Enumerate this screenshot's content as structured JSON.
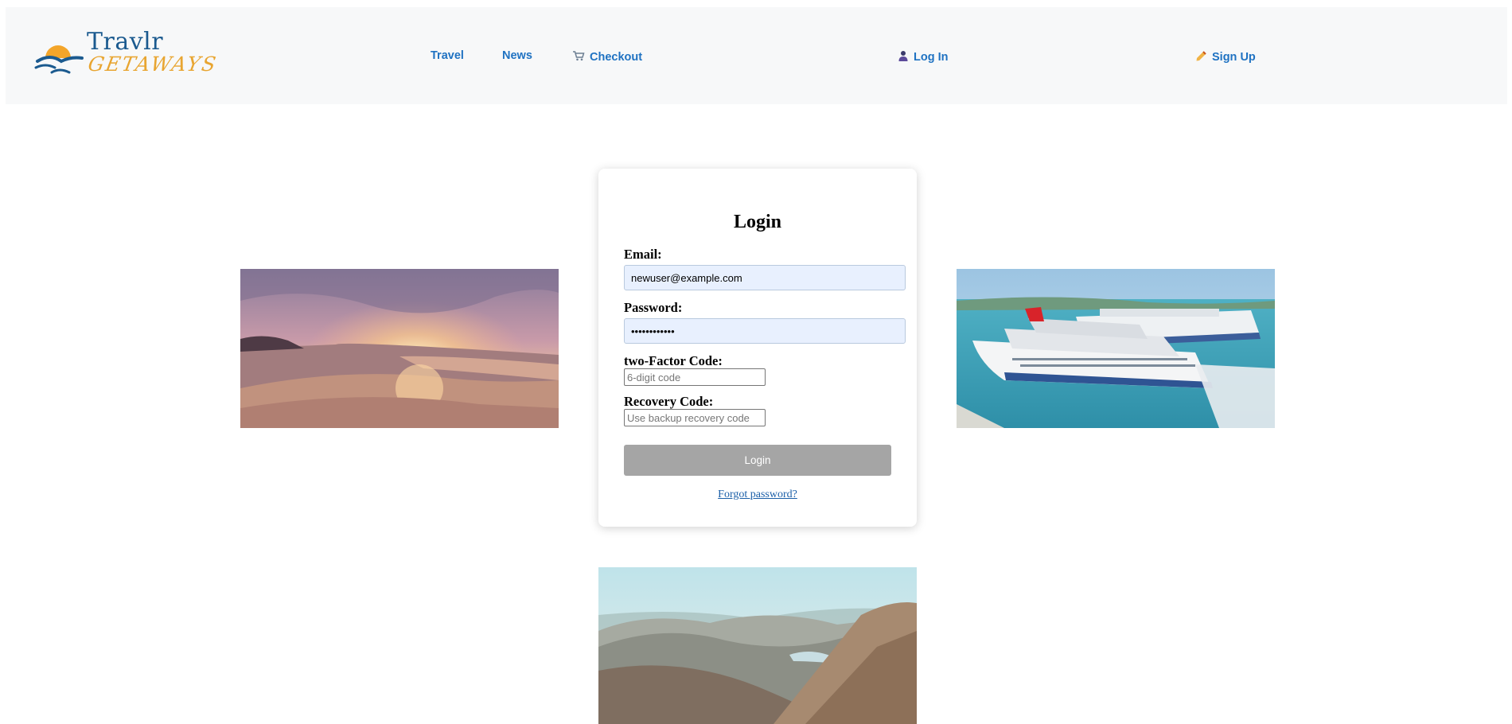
{
  "brand": {
    "line1": "Travlr",
    "line2": "GETAWAYS",
    "colors": {
      "blue": "#1b5a8f",
      "gold": "#e8a531"
    }
  },
  "nav": {
    "travel": "Travel",
    "news": "News",
    "checkout": "Checkout",
    "checkout_icon": "shopping-cart-icon",
    "login": "Log In",
    "login_icon": "user-icon",
    "signup": "Sign Up",
    "signup_icon": "writing-hand-icon",
    "link_color": "#1f72c2"
  },
  "login_form": {
    "title": "Login",
    "email_label": "Email:",
    "email_value": "newuser@example.com",
    "password_label": "Password:",
    "password_value": "••••••••••••",
    "twofactor_label": "two-Factor Code:",
    "twofactor_placeholder": "6-digit code",
    "recovery_label": "Recovery Code:",
    "recovery_placeholder": "Use backup recovery code",
    "submit_label": "Login",
    "forgot_link": "Forgot password?",
    "button_color": "#a5a5a5",
    "autofill_color": "#e8f0fe"
  },
  "images": {
    "left": "beach-sunset-photo",
    "right": "cruise-ships-harbor-photo",
    "bottom": "mountain-landscape-photo"
  }
}
